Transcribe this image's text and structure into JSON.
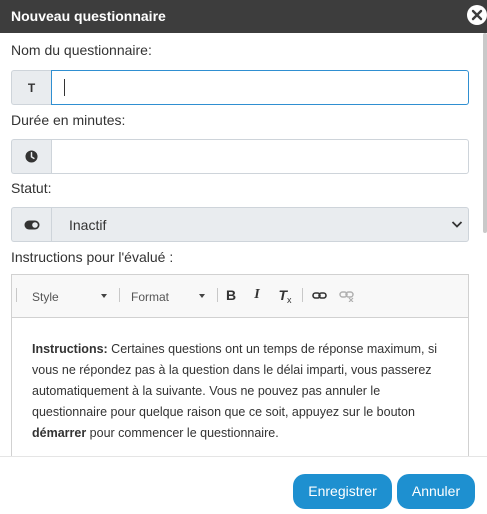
{
  "dialog": {
    "title": "Nouveau questionnaire"
  },
  "form": {
    "name_label": "Nom du questionnaire:",
    "name_addon": "T",
    "name_value": "",
    "duration_label": "Durée en minutes:",
    "duration_value": "",
    "status_label": "Statut:",
    "status_value": "Inactif",
    "instructions_label": "Instructions pour l'évalué :"
  },
  "editor": {
    "style_combo": "Style",
    "format_combo": "Format",
    "bold": "B",
    "italic": "I",
    "clear_format": "T",
    "content": {
      "lead_bold": "Instructions:",
      "text1": " Certaines questions ont un temps de réponse maximum, si vous ne répondez pas à la question dans le délai imparti, vous passerez automatiquement à la suivante. Vous ne pouvez pas annuler le questionnaire pour quelque raison que ce soit, appuyez sur le bouton ",
      "start_bold": "démarrer",
      "text2": " pour commencer le questionnaire."
    }
  },
  "footer": {
    "save_label": "Enregistrer",
    "cancel_label": "Annuler"
  },
  "icons": {
    "close": "close-icon",
    "text": "text-icon",
    "clock": "clock-icon",
    "toggle": "toggle-icon",
    "link": "link-icon",
    "unlink": "unlink-icon"
  },
  "colors": {
    "header_bg": "#3d3d3d",
    "primary": "#1e90d0",
    "focus_border": "#2f8fd1"
  }
}
